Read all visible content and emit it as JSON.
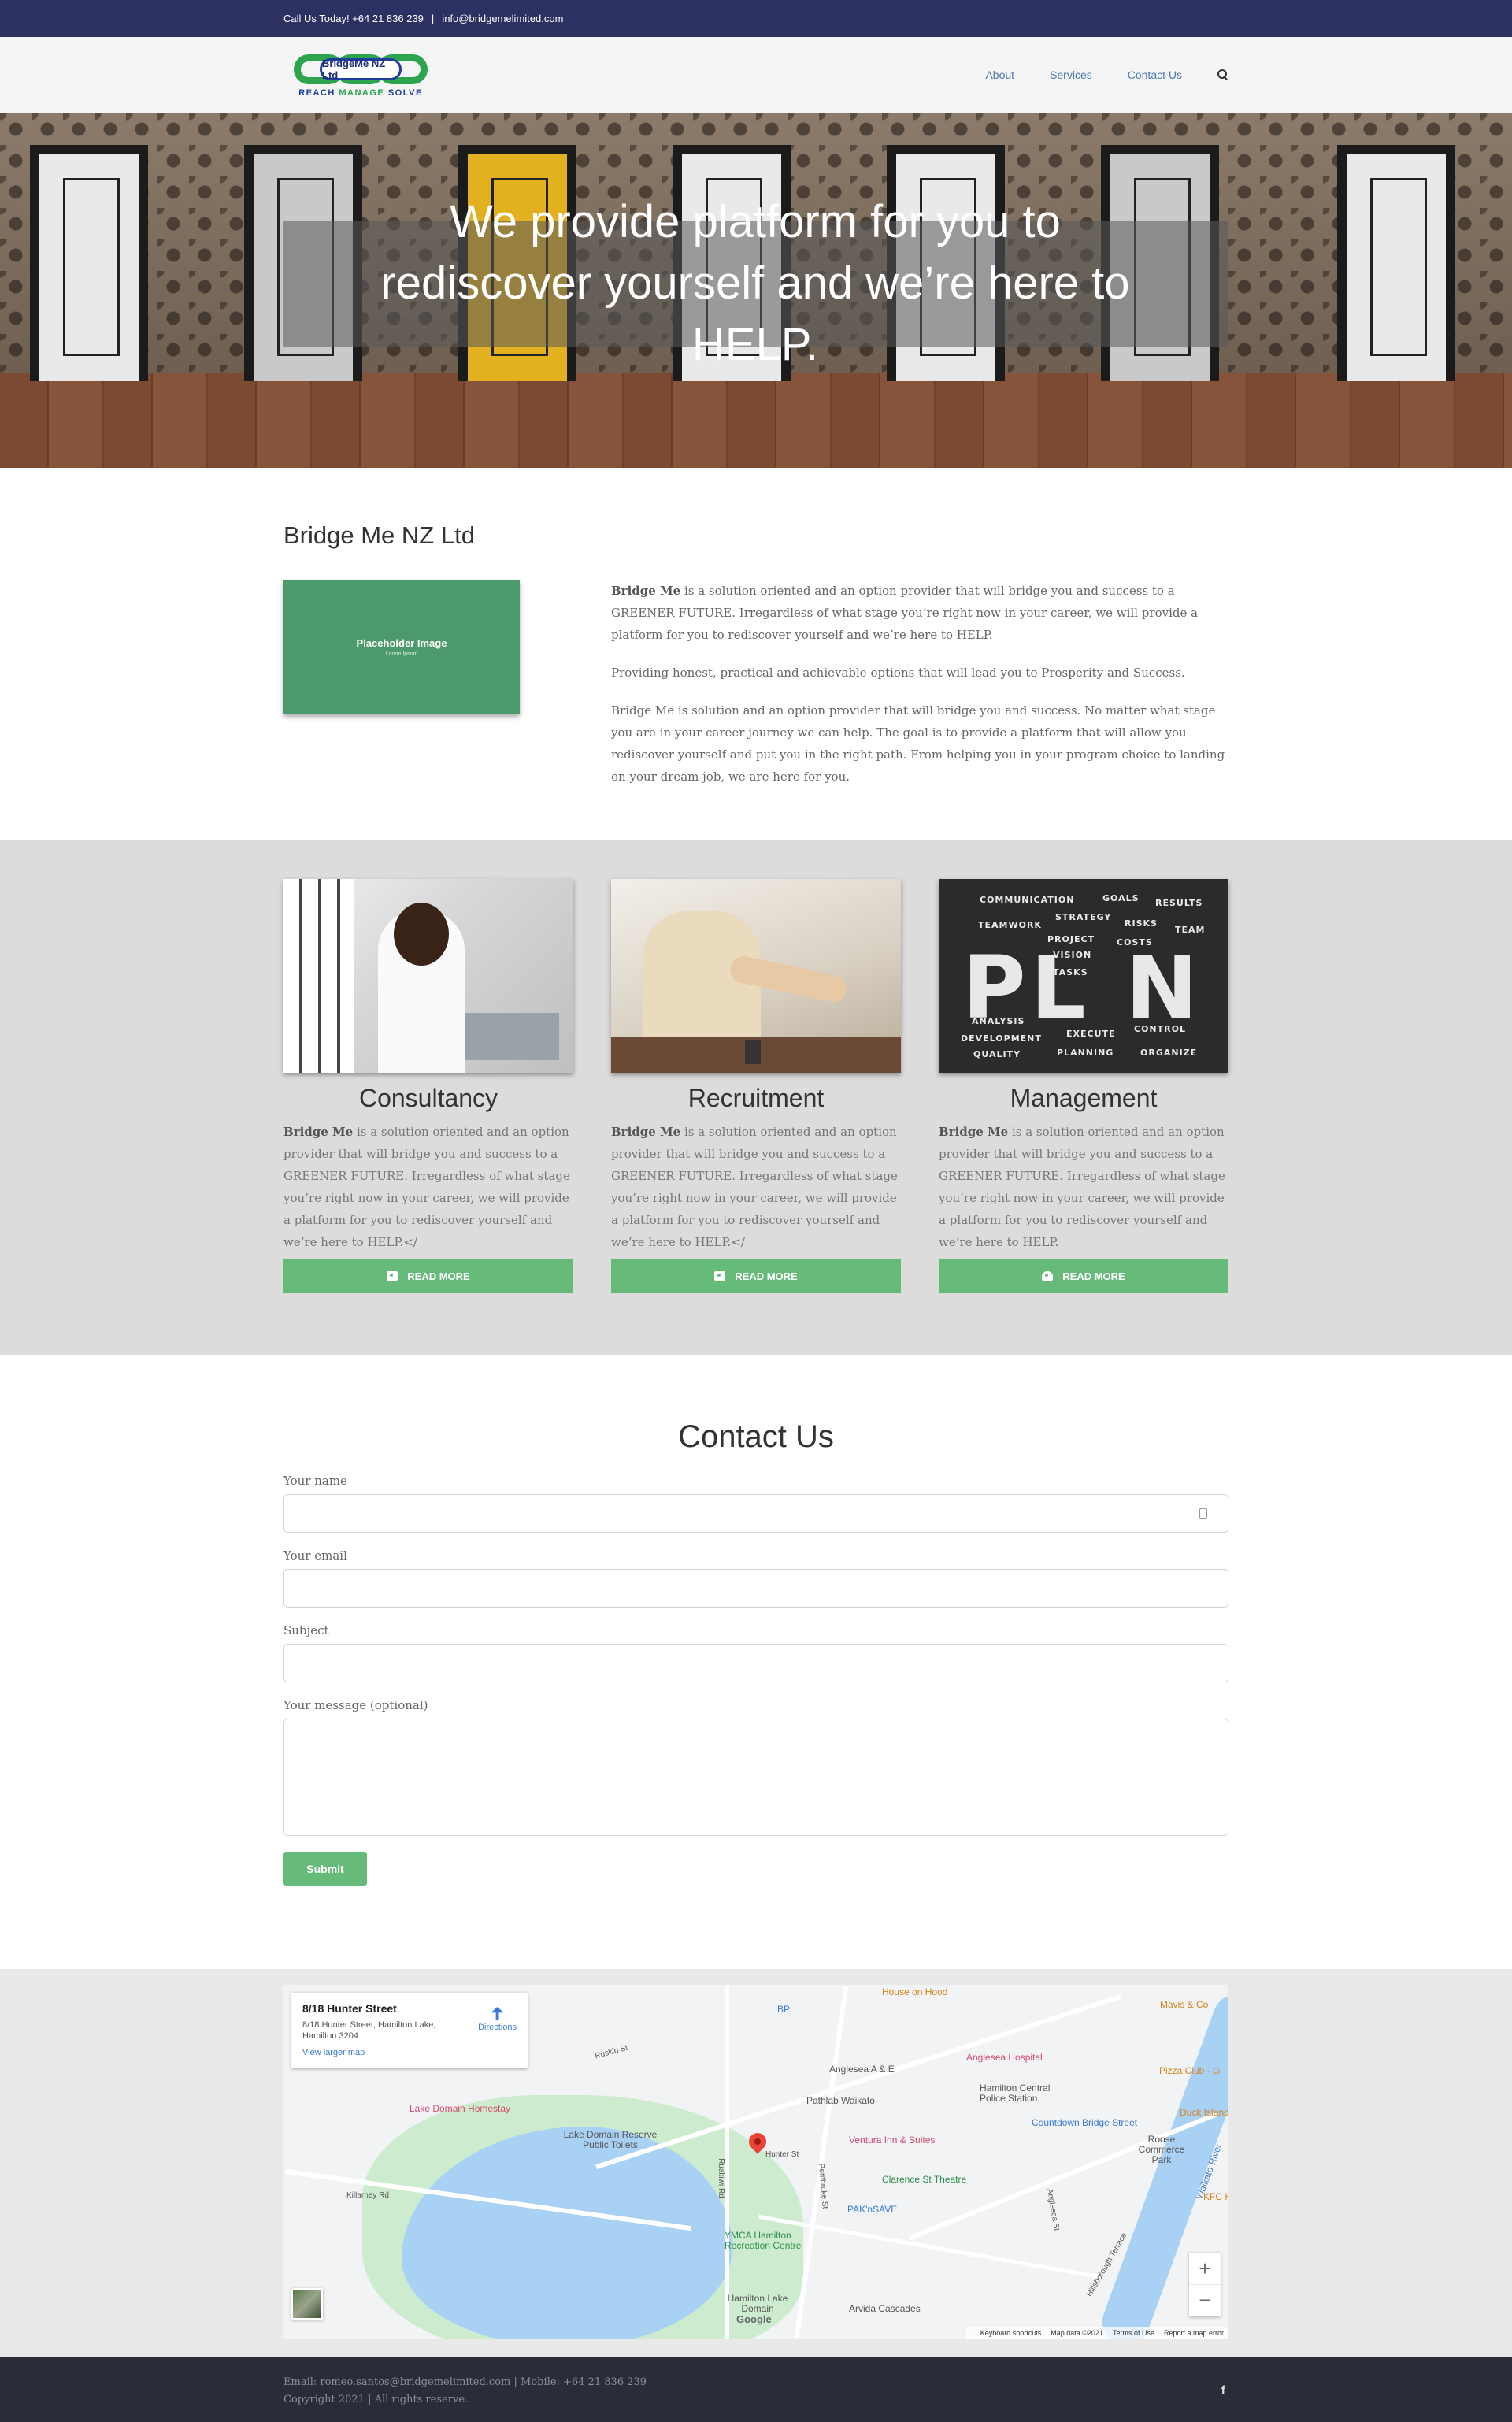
{
  "topbar": {
    "call_text": "Call Us Today! +64 21 836 239",
    "separator": "|",
    "email": "info@bridgemelimited.com"
  },
  "header": {
    "logo_name": "BridgeMe NZ Ltd",
    "logo_tag_1": "REACH",
    "logo_tag_2": "MANAGE",
    "logo_tag_3": "SOLVE",
    "nav": [
      "About",
      "Services",
      "Contact Us"
    ],
    "search_icon": "search-icon"
  },
  "hero": {
    "headline": "We provide platform for you to rediscover yourself and we’re here to HELP."
  },
  "about": {
    "title": "Bridge Me NZ Ltd",
    "placeholder_title": "Placeholder Image",
    "placeholder_sub": "Lorem Ipsum",
    "p1_bold": "Bridge Me",
    "p1_rest": " is a solution oriented and an option provider that will bridge you and success to a GREENER FUTURE. Irregardless of what stage you’re right now in your career, we will provide a platform for you to rediscover yourself and we’re here to HELP.",
    "p2": "Providing honest, practical and achievable options that will lead you to Prosperity and Success.",
    "p3": "Bridge Me is solution and an option provider that will bridge you and success. No matter what stage you are in your career journey we can help. The goal is to provide a platform that will allow you rediscover yourself and put you in the right path. From helping you in your program choice to landing on your dream job, we are here for you."
  },
  "services": [
    {
      "title": "Consultancy",
      "bold": "Bridge Me",
      "text": " is a solution oriented and an option provider that will bridge you and success to a GREENER FUTURE. Irregardless of what stage you’re right now in your career, we will provide a platform for you to rediscover yourself and we’re here to HELP.</",
      "button": "READ MORE",
      "button_icon": "briefcase-icon"
    },
    {
      "title": "Recruitment",
      "bold": "Bridge Me",
      "text": " is a solution oriented and an option provider that will bridge you and success to a GREENER FUTURE. Irregardless of what stage you’re right now in your career, we will provide a platform for you to rediscover yourself and we’re here to HELP.</",
      "button": "READ MORE",
      "button_icon": "briefcase-icon"
    },
    {
      "title": "Management",
      "bold": "Bridge Me",
      "text": " is a solution oriented and an option provider that will bridge you and success to a GREENER FUTURE. Irregardless of what stage you’re right now in your career, we will provide a platform for you to rediscover yourself and we’re here to HELP.",
      "button": "READ MORE",
      "button_icon": "user-plus-icon"
    }
  ],
  "plan_image": {
    "big": "PL N",
    "words": [
      "COMMUNICATION",
      "GOALS",
      "RESULTS",
      "TEAMWORK",
      "STRATEGY",
      "RISKS",
      "TEAM",
      "PROJECT",
      "COSTS",
      "VISION",
      "TASKS",
      "ANALYSIS",
      "DEVELOPMENT",
      "EXECUTE",
      "CONTROL",
      "QUALITY",
      "PLANNING",
      "ORGANIZE"
    ]
  },
  "contact": {
    "title": "Contact Us",
    "name_label": "Your name",
    "email_label": "Your email",
    "subject_label": "Subject",
    "message_label": "Your message (optional)",
    "submit": "Submit"
  },
  "map": {
    "place_title": "8/18 Hunter Street",
    "place_address": "8/18 Hunter Street, Hamilton Lake, Hamilton 3204",
    "directions": "Directions",
    "larger_map": "View larger map",
    "labels": [
      "House on Hood",
      "BP",
      "Anglesea A & E",
      "Anglesea Hospital",
      "Pathlab Waikato",
      "Hamilton Central Police Station",
      "Countdown Bridge Street",
      "Lake Domain Homestay",
      "Lake Domain Reserve Public Toilets",
      "Ventura Inn & Suites",
      "Clarence St Theatre",
      "PAK'nSAVE",
      "YMCA Hamilton Recreation Centre",
      "Hamilton Lake Domain",
      "Arvida Cascades",
      "Mavis & Co",
      "Pizza Club - G",
      "Duck Island",
      "Roose Commerce Park",
      "Waikato River",
      "KFC H",
      "Killarney Rd",
      "Hunter St",
      "Ruakiwi Rd",
      "Pembroke St",
      "Anglesea St",
      "Hillsborough Terrace",
      "Ruskin St"
    ],
    "zoom_in": "+",
    "zoom_out": "−",
    "google": "Google",
    "keyboard": "Keyboard shortcuts",
    "map_data": "Map data ©2021",
    "terms": "Terms of Use",
    "report": "Report a map error"
  },
  "footer": {
    "line1": "Email: romeo.santos@bridgemelimited.com | Mobile: +64 21 836 239",
    "line2": "Copyright 2021 | All rights reserve.",
    "facebook": "f"
  },
  "colors": {
    "topbar": "#2c3162",
    "accent_green": "#66bb7a",
    "nav_link": "#4a79b0",
    "footer": "#2a2d38"
  }
}
